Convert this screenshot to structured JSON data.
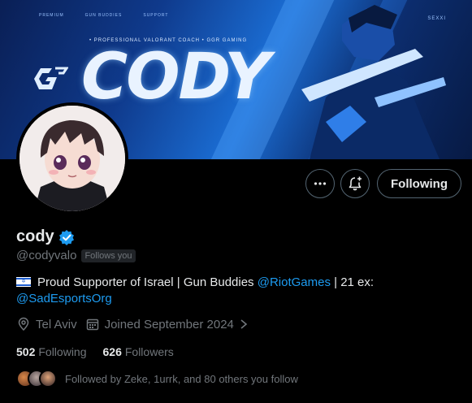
{
  "banner": {
    "nav": [
      "PREMIUM",
      "GUN BUDDIES",
      "SUPPORT"
    ],
    "tagline": "• PROFESSIONAL VALORANT COACH  •  GGR GAMING",
    "title": "CODY",
    "corner": "SEXXI",
    "accent": "#1b6fd6"
  },
  "actions": {
    "more_icon": "more-horizontal-icon",
    "notify_icon": "bell-plus-icon",
    "following_label": "Following"
  },
  "profile": {
    "display_name": "cody",
    "verified_icon": "verified-badge-icon",
    "handle": "@codyvalo",
    "follows_you": "Follows you",
    "bio": {
      "flag_icon": "israel-flag-icon",
      "text1": "Proud Supporter of Israel | Gun Buddies ",
      "mention1": "@RiotGames",
      "text2": " | 21 ex: ",
      "mention2": "@SadEsportsOrg"
    },
    "location": "Tel Aviv",
    "joined": "Joined September 2024",
    "following_count": "502",
    "following_label": "Following",
    "followers_count": "626",
    "followers_label": "Followers",
    "followed_by": "Followed by Zeke, 1urrk, and 80 others you follow"
  },
  "colors": {
    "link": "#1d9bf0",
    "verified": "#1d9bf0",
    "muted": "#71767b",
    "text": "#e7e9ea",
    "border": "#536471"
  }
}
